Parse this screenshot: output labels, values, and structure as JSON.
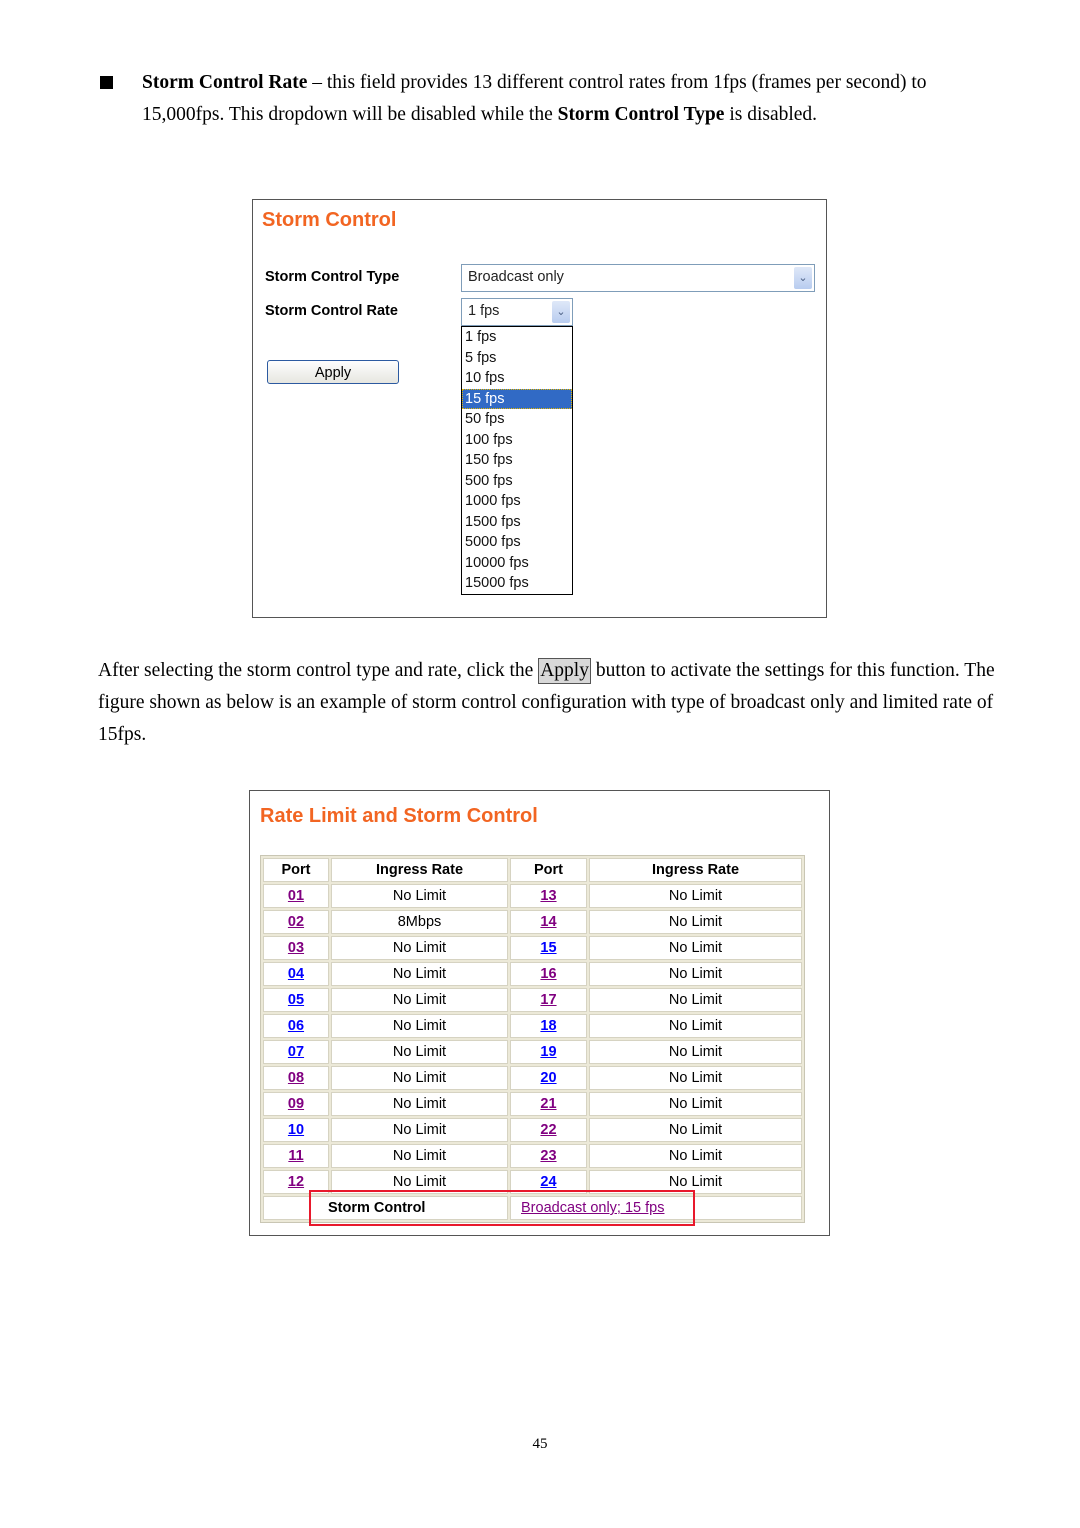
{
  "intro": {
    "bold_term": "Storm Control Rate",
    "text_a": " – this field provides 13 different control rates from 1fps (frames per second) to 15,000fps. This dropdown will be disabled while the ",
    "bold_term2": "Storm Control Type",
    "text_b": " is disabled."
  },
  "panel1": {
    "title": "Storm Control",
    "type_label": "Storm Control Type",
    "type_value": "Broadcast only",
    "rate_label": "Storm Control Rate",
    "rate_value": "1 fps",
    "rate_options": [
      "1 fps",
      "5 fps",
      "10 fps",
      "15 fps",
      "50 fps",
      "100 fps",
      "150 fps",
      "500 fps",
      "1000 fps",
      "1500 fps",
      "5000 fps",
      "10000 fps",
      "15000 fps"
    ],
    "highlighted_option": "15 fps",
    "apply_label": "Apply"
  },
  "para2": {
    "text_a": "After selecting the storm control type and rate, click the ",
    "button_word": "Apply",
    "text_b": " button to activate the settings for this function. The figure shown as below is an example of storm control configuration with type of broadcast only and limited rate of 15fps."
  },
  "panel2": {
    "title": "Rate Limit and Storm Control",
    "headers": [
      "Port",
      "Ingress Rate",
      "Port",
      "Ingress Rate"
    ],
    "rows": [
      {
        "p1": "01",
        "r1": "No Limit",
        "v1": true,
        "p2": "13",
        "r2": "No Limit",
        "v2": true
      },
      {
        "p1": "02",
        "r1": "8Mbps",
        "v1": true,
        "p2": "14",
        "r2": "No Limit",
        "v2": true
      },
      {
        "p1": "03",
        "r1": "No Limit",
        "v1": true,
        "p2": "15",
        "r2": "No Limit",
        "v2": false
      },
      {
        "p1": "04",
        "r1": "No Limit",
        "v1": false,
        "p2": "16",
        "r2": "No Limit",
        "v2": true
      },
      {
        "p1": "05",
        "r1": "No Limit",
        "v1": false,
        "p2": "17",
        "r2": "No Limit",
        "v2": true
      },
      {
        "p1": "06",
        "r1": "No Limit",
        "v1": false,
        "p2": "18",
        "r2": "No Limit",
        "v2": false
      },
      {
        "p1": "07",
        "r1": "No Limit",
        "v1": false,
        "p2": "19",
        "r2": "No Limit",
        "v2": false
      },
      {
        "p1": "08",
        "r1": "No Limit",
        "v1": true,
        "p2": "20",
        "r2": "No Limit",
        "v2": false
      },
      {
        "p1": "09",
        "r1": "No Limit",
        "v1": true,
        "p2": "21",
        "r2": "No Limit",
        "v2": true
      },
      {
        "p1": "10",
        "r1": "No Limit",
        "v1": false,
        "p2": "22",
        "r2": "No Limit",
        "v2": true
      },
      {
        "p1": "11",
        "r1": "No Limit",
        "v1": true,
        "p2": "23",
        "r2": "No Limit",
        "v2": true
      },
      {
        "p1": "12",
        "r1": "No Limit",
        "v1": true,
        "p2": "24",
        "r2": "No Limit",
        "v2": false
      }
    ],
    "storm_label": "Storm Control",
    "storm_value": "Broadcast only; 15 fps"
  },
  "page_number": "45"
}
